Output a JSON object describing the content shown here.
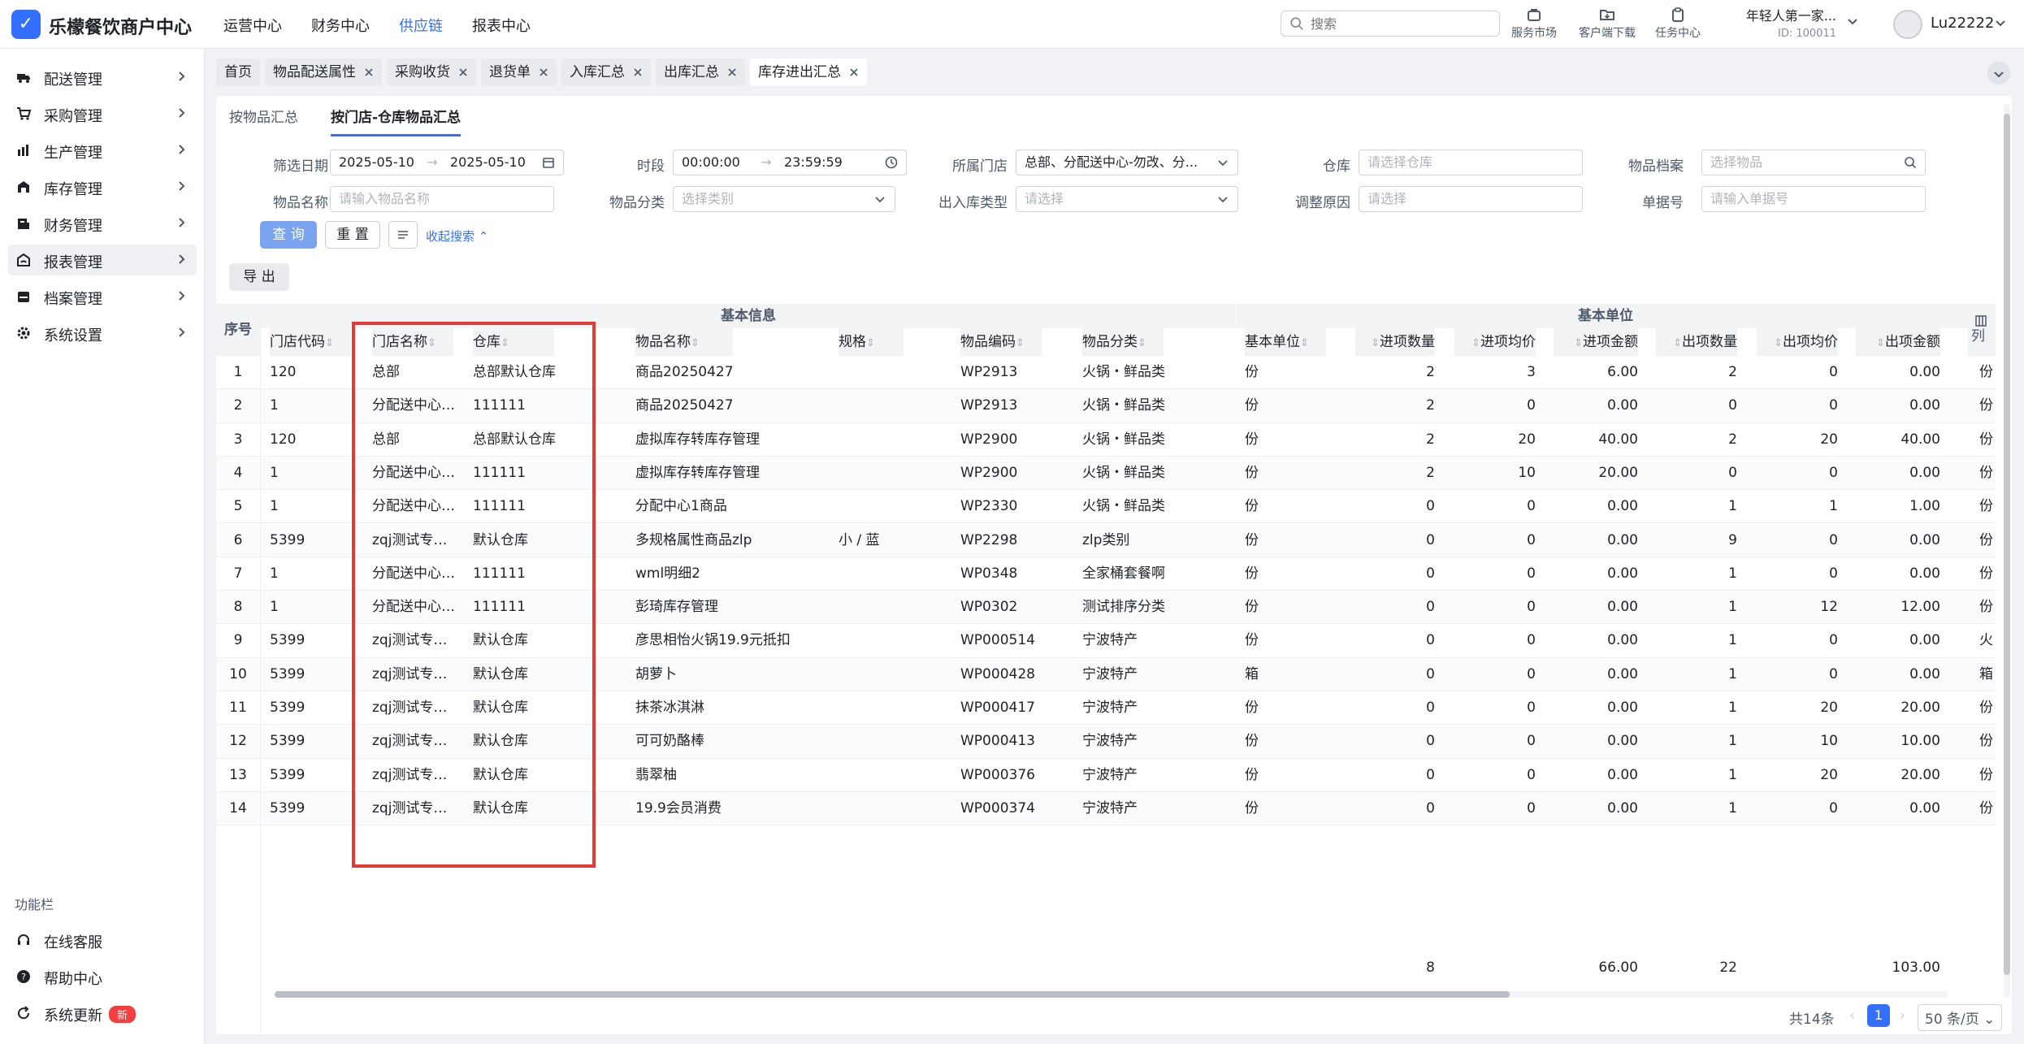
{
  "app": {
    "brand": "乐檬餐饮商户中心",
    "logo_glyph": "✓",
    "top_nav": [
      "运营中心",
      "财务中心",
      "供应链",
      "报表中心"
    ],
    "top_nav_active": 2,
    "search_placeholder": "搜索",
    "tools": [
      "服务市场",
      "客户端下载",
      "任务中心"
    ],
    "store_name": "年轻人第一家...",
    "store_id": "ID: 100011",
    "username": "Lu22222",
    "accent": "#3370ff"
  },
  "sidebar": {
    "items": [
      {
        "label": "配送管理",
        "icon": "truck-icon"
      },
      {
        "label": "采购管理",
        "icon": "cart-icon"
      },
      {
        "label": "生产管理",
        "icon": "factory-icon"
      },
      {
        "label": "库存管理",
        "icon": "warehouse-icon"
      },
      {
        "label": "财务管理",
        "icon": "finance-icon"
      },
      {
        "label": "报表管理",
        "icon": "report-icon"
      },
      {
        "label": "档案管理",
        "icon": "archive-icon"
      },
      {
        "label": "系统设置",
        "icon": "gear-icon"
      }
    ],
    "active_index": 5,
    "section_title": "功能栏",
    "bottom_items": [
      "在线客服",
      "帮助中心",
      "系统更新"
    ],
    "update_badge": "新"
  },
  "tabs": [
    "首页",
    "物品配送属性",
    "采购收货",
    "退货单",
    "入库汇总",
    "出库汇总",
    "库存进出汇总"
  ],
  "subtabs": [
    "按物品汇总",
    "按门店-仓库物品汇总"
  ],
  "filters": {
    "date_label": "筛选日期",
    "date_from": "2025-05-10",
    "date_to": "2025-05-10",
    "period_label": "时段",
    "time_from": "00:00:00",
    "time_to": "23:59:59",
    "store_label": "所属门店",
    "store_value": "总部、分配送中心-勿改、分...",
    "warehouse_label": "仓库",
    "warehouse_ph": "请选择仓库",
    "archive_label": "物品档案",
    "archive_ph": "选择物品",
    "item_name_label": "物品名称",
    "item_name_ph": "请输入物品名称",
    "category_label": "物品分类",
    "category_ph": "选择类别",
    "io_type_label": "出入库类型",
    "io_type_ph": "请选择",
    "reason_label": "调整原因",
    "reason_ph": "请选择",
    "doc_no_label": "单据号",
    "doc_no_ph": "请输入单据号",
    "query_btn": "查 询",
    "reset_btn": "重 置",
    "collapse_link": "收起搜索",
    "export_btn": "导 出"
  },
  "table": {
    "group_basic": "基本信息",
    "group_unit": "基本单位",
    "col_seq": "序号",
    "columns": [
      "门店代码",
      "门店名称",
      "仓库",
      "物品名称",
      "规格",
      "物品编码",
      "物品分类",
      "基本单位",
      "进项数量",
      "进项均价",
      "进项金额",
      "出项数量",
      "出项均价",
      "出项金额"
    ],
    "col_toggle": "列",
    "rows": [
      [
        "1",
        "120",
        "总部",
        "总部默认仓库",
        "商品20250427",
        "",
        "WP2913",
        "火锅・鲜品类",
        "份",
        "2",
        "3",
        "6.00",
        "2",
        "0",
        "0.00",
        "份"
      ],
      [
        "2",
        "1",
        "分配送中心…",
        "111111",
        "商品20250427",
        "",
        "WP2913",
        "火锅・鲜品类",
        "份",
        "2",
        "0",
        "0.00",
        "0",
        "0",
        "0.00",
        "份"
      ],
      [
        "3",
        "120",
        "总部",
        "总部默认仓库",
        "虚拟库存转库存管理",
        "",
        "WP2900",
        "火锅・鲜品类",
        "份",
        "2",
        "20",
        "40.00",
        "2",
        "20",
        "40.00",
        "份"
      ],
      [
        "4",
        "1",
        "分配送中心…",
        "111111",
        "虚拟库存转库存管理",
        "",
        "WP2900",
        "火锅・鲜品类",
        "份",
        "2",
        "10",
        "20.00",
        "0",
        "0",
        "0.00",
        "份"
      ],
      [
        "5",
        "1",
        "分配送中心…",
        "111111",
        "分配中心1商品",
        "",
        "WP2330",
        "火锅・鲜品类",
        "份",
        "0",
        "0",
        "0.00",
        "1",
        "1",
        "1.00",
        "份"
      ],
      [
        "6",
        "5399",
        "zqj测试专…",
        "默认仓库",
        "多规格属性商品zlp",
        "小 / 蓝",
        "WP2298",
        "zlp类别",
        "份",
        "0",
        "0",
        "0.00",
        "9",
        "0",
        "0.00",
        "份"
      ],
      [
        "7",
        "1",
        "分配送中心…",
        "111111",
        "wml明细2",
        "",
        "WP0348",
        "全家桶套餐啊",
        "份",
        "0",
        "0",
        "0.00",
        "1",
        "0",
        "0.00",
        "份"
      ],
      [
        "8",
        "1",
        "分配送中心…",
        "111111",
        "彭琦库存管理",
        "",
        "WP0302",
        "测试排序分类",
        "份",
        "0",
        "0",
        "0.00",
        "1",
        "12",
        "12.00",
        "份"
      ],
      [
        "9",
        "5399",
        "zqj测试专…",
        "默认仓库",
        "彦思相怡火锅19.9元抵扣",
        "",
        "WP000514",
        "宁波特产",
        "份",
        "0",
        "0",
        "0.00",
        "1",
        "0",
        "0.00",
        "火"
      ],
      [
        "10",
        "5399",
        "zqj测试专…",
        "默认仓库",
        "胡萝卜",
        "",
        "WP000428",
        "宁波特产",
        "箱",
        "0",
        "0",
        "0.00",
        "1",
        "0",
        "0.00",
        "箱"
      ],
      [
        "11",
        "5399",
        "zqj测试专…",
        "默认仓库",
        "抹茶冰淇淋",
        "",
        "WP000417",
        "宁波特产",
        "份",
        "0",
        "0",
        "0.00",
        "1",
        "20",
        "20.00",
        "份"
      ],
      [
        "12",
        "5399",
        "zqj测试专…",
        "默认仓库",
        "可可奶酪棒",
        "",
        "WP000413",
        "宁波特产",
        "份",
        "0",
        "0",
        "0.00",
        "1",
        "10",
        "10.00",
        "份"
      ],
      [
        "13",
        "5399",
        "zqj测试专…",
        "默认仓库",
        "翡翠柚",
        "",
        "WP000376",
        "宁波特产",
        "份",
        "0",
        "0",
        "0.00",
        "1",
        "20",
        "20.00",
        "份"
      ],
      [
        "14",
        "5399",
        "zqj测试专…",
        "默认仓库",
        "19.9会员消费",
        "",
        "WP000374",
        "宁波特产",
        "份",
        "0",
        "0",
        "0.00",
        "1",
        "0",
        "0.00",
        "份"
      ]
    ],
    "totals": {
      "in_qty": "8",
      "in_amount": "66.00",
      "out_qty": "22",
      "out_amount": "103.00"
    }
  },
  "pagination": {
    "total": "共14条",
    "current_page": "1",
    "page_size": "50 条/页"
  },
  "highlight_color": "#e53935"
}
